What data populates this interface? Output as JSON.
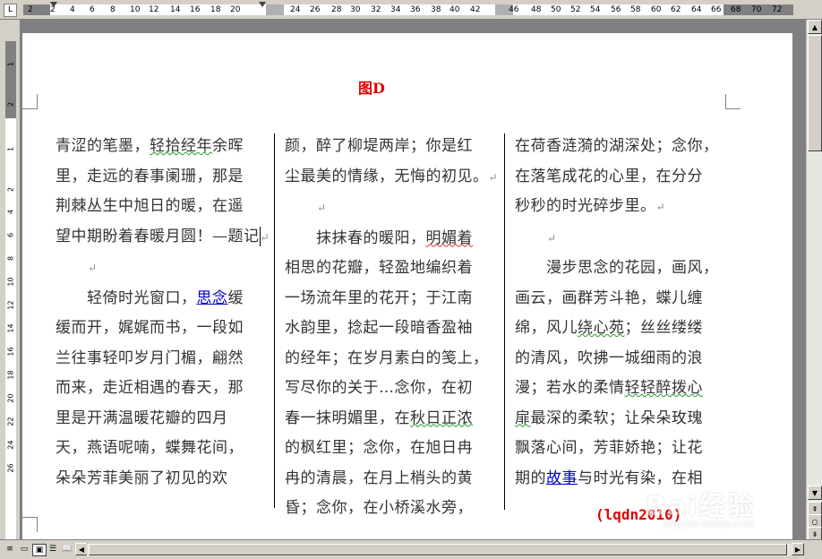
{
  "ruler": {
    "corner_glyph": "L",
    "numbers": [
      "2",
      "2",
      "4",
      "6",
      "8",
      "10",
      "12",
      "14",
      "16",
      "18",
      "20",
      "24",
      "26",
      "28",
      "30",
      "32",
      "34",
      "36",
      "38",
      "40",
      "42",
      "46",
      "48",
      "50",
      "52",
      "54",
      "56",
      "58",
      "60",
      "62",
      "64",
      "66",
      "68",
      "70",
      "72"
    ],
    "left_numbers": [
      "1",
      "2",
      "1",
      "2",
      "4",
      "6",
      "8",
      "10",
      "12",
      "14",
      "16",
      "18",
      "20",
      "22",
      "24",
      "26"
    ]
  },
  "document": {
    "title": "图D",
    "columns": [
      {
        "lines": [
          "青涩的笔墨，轻拾经年余晖",
          "里，走远的春事阑珊，那是",
          "荆棘丛生中旭日的暖，在遥",
          "望中期盼着春暖月圆！—题记",
          "",
          "　　轻倚时光窗口，思念缓",
          "缓而开，娓娓而书，一段如",
          "兰往事轻叩岁月门楣，翩然",
          "而来，走近相遇的春天，那",
          "里是开满温暖花瓣的四月",
          "天，燕语呢喃，蝶舞花间，",
          "朵朵芳菲美丽了初见的欢"
        ]
      },
      {
        "lines": [
          "颜，醉了柳堤两岸；你是红",
          "尘最美的情缘，无悔的初见。",
          "",
          "　　抹抹春的暖阳，明媚着",
          "相思的花瓣，轻盈地编织着",
          "一场流年里的花开；于江南",
          "水韵里，捻起一段暗香盈袖",
          "的经年；在岁月素白的笺上，",
          "写尽你的关于…念你，在初",
          "春一抹明媚里，在秋日正浓",
          "的枫红里；念你，在旭日冉",
          "冉的清晨，在月上梢头的黄",
          "昏；念你，在小桥溪水旁，"
        ]
      },
      {
        "lines": [
          "在荷香涟漪的湖深处；念你，",
          "在落笔成花的心里，在分分",
          "秒秒的时光碎步里。",
          "",
          "　　漫步思念的花园，画风，",
          "画云，画群芳斗艳，蝶儿缠",
          "绵，风儿绕心苑；丝丝缕缕",
          "的清风，吹拂一城细雨的浪",
          "漫；若水的柔情轻轻醉拨心",
          "扉最深的柔软；让朵朵玫瑰",
          "飘落心间，芳菲娇艳；让花",
          "期的故事与时光有染，在相"
        ]
      }
    ],
    "credit": "(lqdn2010)"
  },
  "watermark": {
    "text": "Bai经验",
    "sub": "jingyan.baidu.com"
  },
  "icons": {
    "pilcrow": "↵",
    "scroll_up": "▲",
    "scroll_down": "▼",
    "prev_page": "⇞",
    "browse_object": "○",
    "next_page": "⇟",
    "scroll_left": "◀",
    "scroll_right": "▶"
  },
  "view_buttons": [
    "≡",
    "▭",
    "▣",
    "☰",
    "📖"
  ]
}
